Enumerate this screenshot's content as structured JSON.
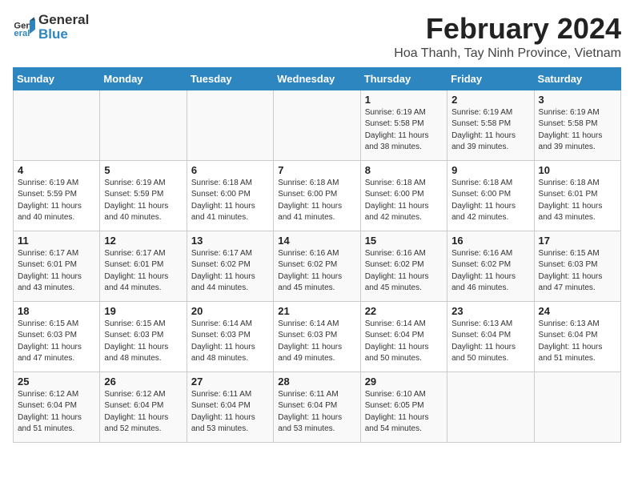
{
  "header": {
    "logo_general": "General",
    "logo_blue": "Blue",
    "title": "February 2024",
    "subtitle": "Hoa Thanh, Tay Ninh Province, Vietnam"
  },
  "calendar": {
    "days_of_week": [
      "Sunday",
      "Monday",
      "Tuesday",
      "Wednesday",
      "Thursday",
      "Friday",
      "Saturday"
    ],
    "weeks": [
      [
        {
          "day": "",
          "info": ""
        },
        {
          "day": "",
          "info": ""
        },
        {
          "day": "",
          "info": ""
        },
        {
          "day": "",
          "info": ""
        },
        {
          "day": "1",
          "info": "Sunrise: 6:19 AM\nSunset: 5:58 PM\nDaylight: 11 hours\nand 38 minutes."
        },
        {
          "day": "2",
          "info": "Sunrise: 6:19 AM\nSunset: 5:58 PM\nDaylight: 11 hours\nand 39 minutes."
        },
        {
          "day": "3",
          "info": "Sunrise: 6:19 AM\nSunset: 5:58 PM\nDaylight: 11 hours\nand 39 minutes."
        }
      ],
      [
        {
          "day": "4",
          "info": "Sunrise: 6:19 AM\nSunset: 5:59 PM\nDaylight: 11 hours\nand 40 minutes."
        },
        {
          "day": "5",
          "info": "Sunrise: 6:19 AM\nSunset: 5:59 PM\nDaylight: 11 hours\nand 40 minutes."
        },
        {
          "day": "6",
          "info": "Sunrise: 6:18 AM\nSunset: 6:00 PM\nDaylight: 11 hours\nand 41 minutes."
        },
        {
          "day": "7",
          "info": "Sunrise: 6:18 AM\nSunset: 6:00 PM\nDaylight: 11 hours\nand 41 minutes."
        },
        {
          "day": "8",
          "info": "Sunrise: 6:18 AM\nSunset: 6:00 PM\nDaylight: 11 hours\nand 42 minutes."
        },
        {
          "day": "9",
          "info": "Sunrise: 6:18 AM\nSunset: 6:00 PM\nDaylight: 11 hours\nand 42 minutes."
        },
        {
          "day": "10",
          "info": "Sunrise: 6:18 AM\nSunset: 6:01 PM\nDaylight: 11 hours\nand 43 minutes."
        }
      ],
      [
        {
          "day": "11",
          "info": "Sunrise: 6:17 AM\nSunset: 6:01 PM\nDaylight: 11 hours\nand 43 minutes."
        },
        {
          "day": "12",
          "info": "Sunrise: 6:17 AM\nSunset: 6:01 PM\nDaylight: 11 hours\nand 44 minutes."
        },
        {
          "day": "13",
          "info": "Sunrise: 6:17 AM\nSunset: 6:02 PM\nDaylight: 11 hours\nand 44 minutes."
        },
        {
          "day": "14",
          "info": "Sunrise: 6:16 AM\nSunset: 6:02 PM\nDaylight: 11 hours\nand 45 minutes."
        },
        {
          "day": "15",
          "info": "Sunrise: 6:16 AM\nSunset: 6:02 PM\nDaylight: 11 hours\nand 45 minutes."
        },
        {
          "day": "16",
          "info": "Sunrise: 6:16 AM\nSunset: 6:02 PM\nDaylight: 11 hours\nand 46 minutes."
        },
        {
          "day": "17",
          "info": "Sunrise: 6:15 AM\nSunset: 6:03 PM\nDaylight: 11 hours\nand 47 minutes."
        }
      ],
      [
        {
          "day": "18",
          "info": "Sunrise: 6:15 AM\nSunset: 6:03 PM\nDaylight: 11 hours\nand 47 minutes."
        },
        {
          "day": "19",
          "info": "Sunrise: 6:15 AM\nSunset: 6:03 PM\nDaylight: 11 hours\nand 48 minutes."
        },
        {
          "day": "20",
          "info": "Sunrise: 6:14 AM\nSunset: 6:03 PM\nDaylight: 11 hours\nand 48 minutes."
        },
        {
          "day": "21",
          "info": "Sunrise: 6:14 AM\nSunset: 6:03 PM\nDaylight: 11 hours\nand 49 minutes."
        },
        {
          "day": "22",
          "info": "Sunrise: 6:14 AM\nSunset: 6:04 PM\nDaylight: 11 hours\nand 50 minutes."
        },
        {
          "day": "23",
          "info": "Sunrise: 6:13 AM\nSunset: 6:04 PM\nDaylight: 11 hours\nand 50 minutes."
        },
        {
          "day": "24",
          "info": "Sunrise: 6:13 AM\nSunset: 6:04 PM\nDaylight: 11 hours\nand 51 minutes."
        }
      ],
      [
        {
          "day": "25",
          "info": "Sunrise: 6:12 AM\nSunset: 6:04 PM\nDaylight: 11 hours\nand 51 minutes."
        },
        {
          "day": "26",
          "info": "Sunrise: 6:12 AM\nSunset: 6:04 PM\nDaylight: 11 hours\nand 52 minutes."
        },
        {
          "day": "27",
          "info": "Sunrise: 6:11 AM\nSunset: 6:04 PM\nDaylight: 11 hours\nand 53 minutes."
        },
        {
          "day": "28",
          "info": "Sunrise: 6:11 AM\nSunset: 6:04 PM\nDaylight: 11 hours\nand 53 minutes."
        },
        {
          "day": "29",
          "info": "Sunrise: 6:10 AM\nSunset: 6:05 PM\nDaylight: 11 hours\nand 54 minutes."
        },
        {
          "day": "",
          "info": ""
        },
        {
          "day": "",
          "info": ""
        }
      ]
    ]
  }
}
